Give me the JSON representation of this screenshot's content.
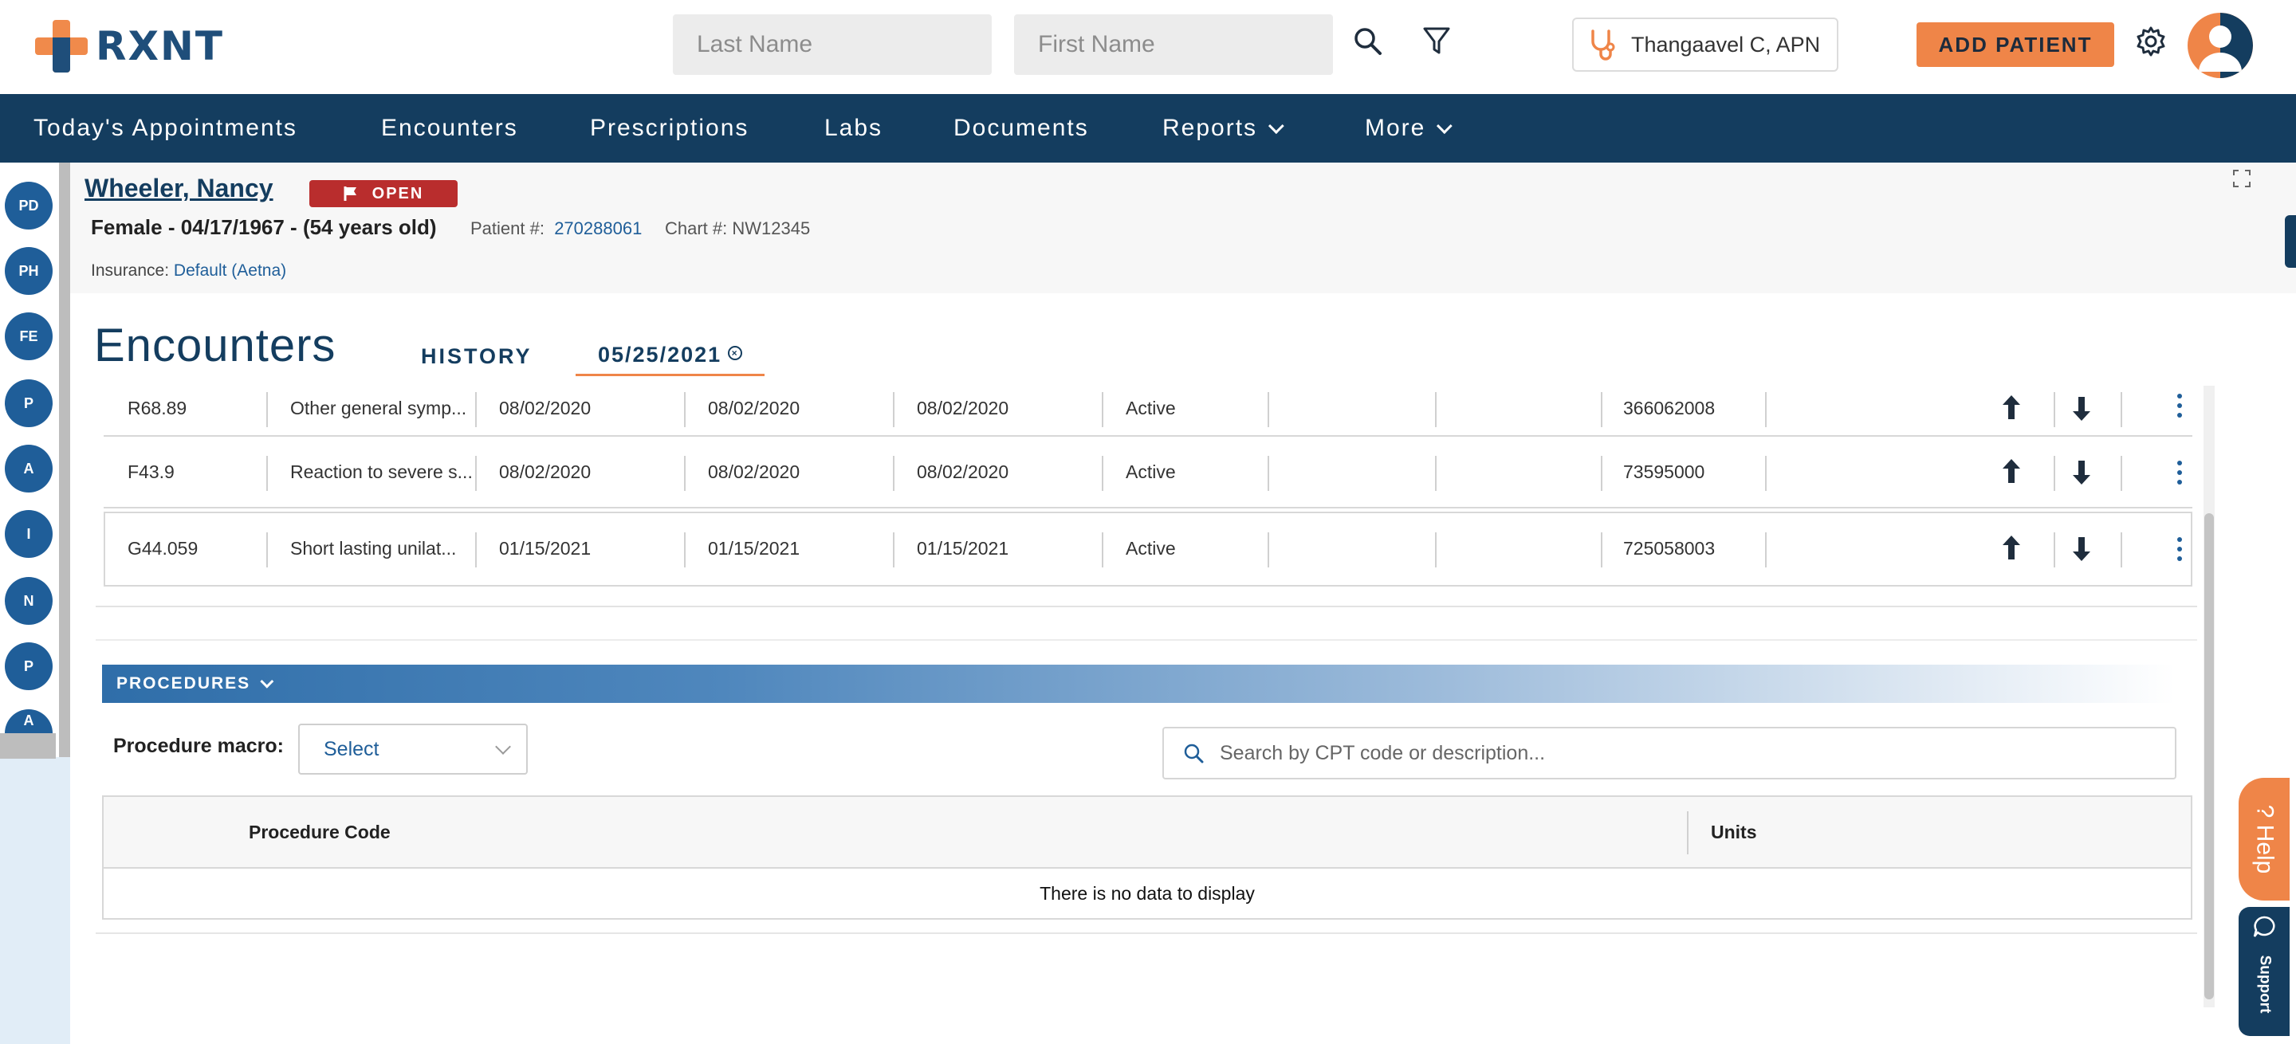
{
  "app": {
    "logo_text": "RXNT"
  },
  "header": {
    "last_name_placeholder": "Last Name",
    "first_name_placeholder": "First Name",
    "provider_name": "Thangaavel C, APN",
    "add_patient_label": "ADD PATIENT"
  },
  "nav": {
    "items": [
      {
        "label": "Today's Appointments"
      },
      {
        "label": "Encounters"
      },
      {
        "label": "Prescriptions"
      },
      {
        "label": "Labs"
      },
      {
        "label": "Documents"
      },
      {
        "label": "Reports"
      },
      {
        "label": "More"
      }
    ]
  },
  "sidebar": {
    "items": [
      "PD",
      "PH",
      "FE",
      "P",
      "A",
      "I",
      "N",
      "P",
      "A"
    ]
  },
  "patient": {
    "name": "Wheeler, Nancy",
    "status": "OPEN",
    "demographics": "Female - 04/17/1967 - (54 years old)",
    "patient_no_label": "Patient #:",
    "patient_no": "270288061",
    "chart_no_label": "Chart #:",
    "chart_no": "NW12345",
    "insurance_label": "Insurance:",
    "insurance": "Default (Aetna)"
  },
  "encounters": {
    "title": "Encounters",
    "tabs": {
      "history": "HISTORY",
      "date": "05/25/2021"
    },
    "rows": [
      {
        "code": "R68.89",
        "description": "Other general symp...",
        "date1": "08/02/2020",
        "date2": "08/02/2020",
        "date3": "08/02/2020",
        "status": "Active",
        "snomed": "366062008"
      },
      {
        "code": "F43.9",
        "description": "Reaction to severe s...",
        "date1": "08/02/2020",
        "date2": "08/02/2020",
        "date3": "08/02/2020",
        "status": "Active",
        "snomed": "73595000"
      },
      {
        "code": "G44.059",
        "description": "Short lasting unilat...",
        "date1": "01/15/2021",
        "date2": "01/15/2021",
        "date3": "01/15/2021",
        "status": "Active",
        "snomed": "725058003"
      }
    ]
  },
  "procedures": {
    "section_label": "PROCEDURES",
    "macro_label": "Procedure macro:",
    "macro_value": "Select",
    "search_placeholder": "Search by CPT code or description...",
    "columns": [
      "Procedure Code",
      "Units"
    ],
    "empty_text": "There is no data to display"
  },
  "widgets": {
    "help_label": "? Help",
    "support_label": "Support"
  },
  "colors": {
    "navy": "#143d5f",
    "orange": "#ef8548",
    "blue": "#1f5e99",
    "open_badge": "#b92d2d"
  }
}
